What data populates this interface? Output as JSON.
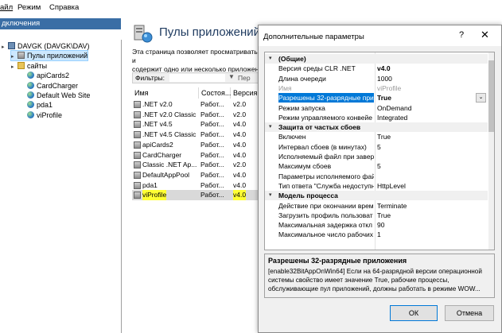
{
  "menu": {
    "items": [
      "айл",
      "Режим",
      "Справка"
    ]
  },
  "connections": {
    "title": "дключения",
    "tree": [
      {
        "label": "DAVGK (DAVGK\\DAV)",
        "icon": "server-icon",
        "indent": 0
      },
      {
        "label": "Пулы приложений",
        "icon": "app-pool-icon",
        "indent": 1,
        "selected": true
      },
      {
        "label": "сайты",
        "icon": "folder-icon",
        "indent": 1
      },
      {
        "label": "apiCards2",
        "icon": "globe-icon",
        "indent": 2
      },
      {
        "label": "CardCharger",
        "icon": "globe-icon",
        "indent": 2
      },
      {
        "label": "Default Web Site",
        "icon": "globe-icon",
        "indent": 2
      },
      {
        "label": "pda1",
        "icon": "globe-icon",
        "indent": 2
      },
      {
        "label": "viProfile",
        "icon": "globe-icon",
        "indent": 2
      }
    ]
  },
  "pools": {
    "title": "Пулы приложений",
    "description_line1": "Эта страница позволяет просматривать и",
    "description_line2": "содержит одно или несколько приложен",
    "filter_label": "Фильтры:",
    "filter_go": "Пер",
    "columns": [
      "Имя",
      "Состоя...",
      "Версия"
    ],
    "rows": [
      {
        "name": ".NET v2.0",
        "status": "Работ...",
        "version": "v2.0"
      },
      {
        "name": ".NET v2.0 Classic",
        "status": "Работ...",
        "version": "v2.0"
      },
      {
        "name": ".NET v4.5",
        "status": "Работ...",
        "version": "v4.0"
      },
      {
        "name": ".NET v4.5 Classic",
        "status": "Работ...",
        "version": "v4.0"
      },
      {
        "name": "apiCards2",
        "status": "Работ...",
        "version": "v4.0"
      },
      {
        "name": "CardCharger",
        "status": "Работ...",
        "version": "v4.0"
      },
      {
        "name": "Classic .NET Ap...",
        "status": "Работ...",
        "version": "v2.0"
      },
      {
        "name": "DefaultAppPool",
        "status": "Работ...",
        "version": "v4.0"
      },
      {
        "name": "pda1",
        "status": "Работ...",
        "version": "v4.0"
      },
      {
        "name": "viProfile",
        "status": "Работ...",
        "version": "v4.0",
        "selected": true
      }
    ]
  },
  "dialog": {
    "title": "Дополнительные параметры",
    "help": "?",
    "close": "✕",
    "rows": [
      {
        "type": "cat",
        "key": "(Общие)",
        "toggle": "▾"
      },
      {
        "key": "Версия среды CLR .NET",
        "value": "v4.0",
        "bold": true
      },
      {
        "key": "Длина очереди",
        "value": "1000"
      },
      {
        "key": "Имя",
        "value": "viProfile",
        "dim": true
      },
      {
        "key": "Разрешены 32-разрядные при",
        "value": "True",
        "selected": true,
        "bold": true
      },
      {
        "key": "Режим запуска",
        "value": "OnDemand"
      },
      {
        "key": "Режим управляемого конвейе",
        "value": "Integrated"
      },
      {
        "type": "cat",
        "key": "Защита от частых сбоев",
        "toggle": "▾"
      },
      {
        "key": "Включен",
        "value": "True"
      },
      {
        "key": "Интервал сбоев (в минутах)",
        "value": "5"
      },
      {
        "key": "Исполняемый файл при завер",
        "value": ""
      },
      {
        "key": "Максимум сбоев",
        "value": "5"
      },
      {
        "key": "Параметры исполняемого фай",
        "value": ""
      },
      {
        "key": "Тип ответа \"Служба недоступн",
        "value": "HttpLevel"
      },
      {
        "type": "cat",
        "key": "Модель процесса",
        "toggle": "▾"
      },
      {
        "key": "Действие при окончании врем",
        "value": "Terminate"
      },
      {
        "key": "Загрузить профиль пользоват",
        "value": "True"
      },
      {
        "key": "Максимальная задержка откл",
        "value": "90"
      },
      {
        "key": "Максимальное число рабочих",
        "value": "1"
      }
    ],
    "dropdown_glyph": "⌄",
    "desc_title": "Разрешены 32-разрядные приложения",
    "desc_lines": [
      "[enable32BitAppOnWin64] Если на 64-разрядной версии операционной",
      "системы свойство имеет значение True, рабочие процессы,",
      "обслуживающие пул приложений, должны работать в режиме WOW..."
    ],
    "ok_label": "ОК",
    "cancel_label": "Отмена"
  },
  "colors": {
    "highlight": "#ffff33",
    "selection": "#0078d7",
    "connections_header": "#3a6ea5"
  }
}
